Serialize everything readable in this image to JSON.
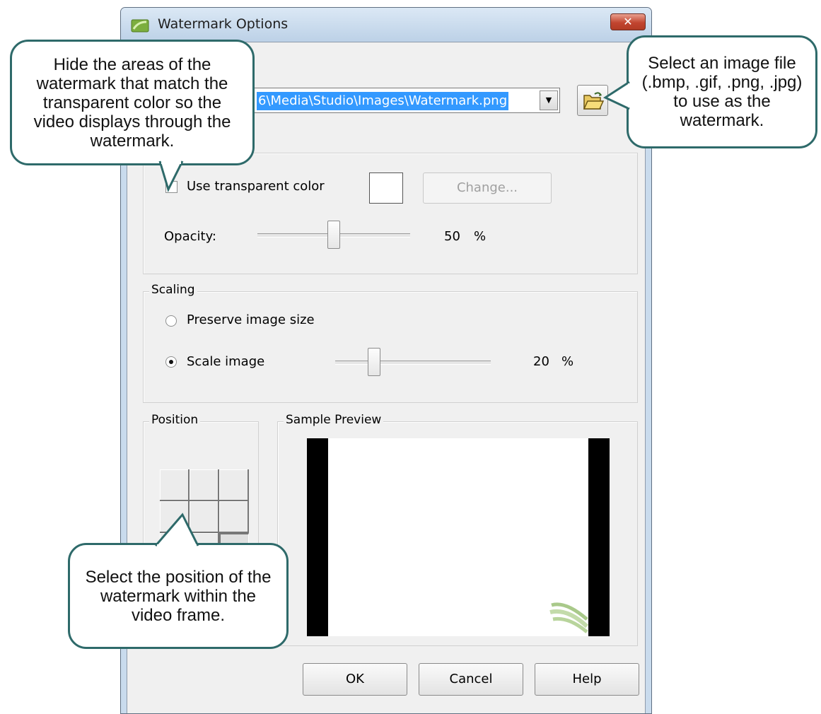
{
  "window": {
    "title": "Watermark Options",
    "close_glyph": "✕"
  },
  "file": {
    "path": "6\\Media\\Studio\\Images\\Watermark.png",
    "dropdown_icon": "chevron-down-icon",
    "browse_icon": "open-folder-icon"
  },
  "transparency": {
    "use_transparent_label": "Use transparent color",
    "use_transparent_checked": false,
    "change_label": "Change...",
    "opacity_label": "Opacity:",
    "opacity_value": "50",
    "opacity_unit": "%",
    "opacity_fraction": 0.5
  },
  "scaling": {
    "group_label": "Scaling",
    "preserve_label": "Preserve image size",
    "scale_label": "Scale image",
    "selected": "scale",
    "scale_value": "20",
    "scale_unit": "%",
    "scale_fraction": 0.25
  },
  "position": {
    "group_label": "Position",
    "selected_cell": "bottom-right"
  },
  "preview": {
    "group_label": "Sample Preview"
  },
  "buttons": {
    "ok": "OK",
    "cancel": "Cancel",
    "help": "Help"
  },
  "callouts": {
    "transparent": "Hide the areas of the watermark that match the transparent color so the video displays through the watermark.",
    "file": "Select an image file (.bmp, .gif, .png, .jpg) to use as the watermark.",
    "position": "Select the position of the watermark within the video frame."
  },
  "colors": {
    "selection": "#3399ff",
    "callout_border": "#2e6a6a",
    "dialog_bg": "#f0f0f0",
    "close_button": "#c24530"
  }
}
